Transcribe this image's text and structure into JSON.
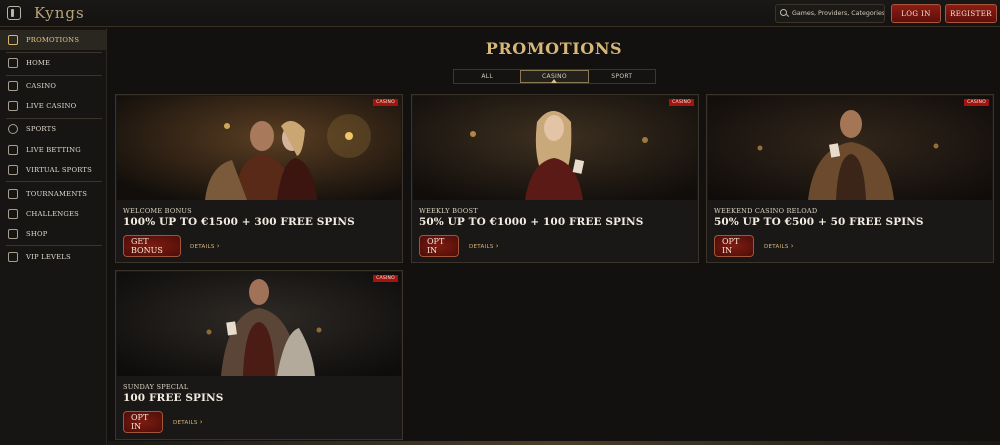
{
  "header": {
    "logo": "Kyngs",
    "search_placeholder": "Games, Providers, Categories",
    "login_label": "LOG IN",
    "register_label": "REGISTER"
  },
  "sidebar": {
    "items": [
      {
        "label": "PROMOTIONS",
        "icon": "gift-icon"
      },
      {
        "label": "HOME",
        "icon": "home-icon"
      },
      {
        "label": "CASINO",
        "icon": "casino-icon"
      },
      {
        "label": "LIVE CASINO",
        "icon": "live-casino-icon"
      },
      {
        "label": "SPORTS",
        "icon": "sports-icon"
      },
      {
        "label": "LIVE BETTING",
        "icon": "live-betting-icon"
      },
      {
        "label": "VIRTUAL SPORTS",
        "icon": "virtual-sports-icon"
      },
      {
        "label": "TOURNAMENTS",
        "icon": "trophy-icon"
      },
      {
        "label": "CHALLENGES",
        "icon": "challenges-icon"
      },
      {
        "label": "SHOP",
        "icon": "shop-icon"
      },
      {
        "label": "VIP LEVELS",
        "icon": "diamond-icon"
      }
    ]
  },
  "main": {
    "title": "PROMOTIONS",
    "tabs": [
      "ALL",
      "CASINO",
      "SPORT"
    ],
    "active_tab": "CASINO",
    "cards": [
      {
        "badge": "CASINO",
        "subtitle": "WELCOME BONUS",
        "title": "100% UP TO €1500 + 300 FREE SPINS",
        "button": "GET BONUS",
        "details": "DETAILS"
      },
      {
        "badge": "CASINO",
        "subtitle": "WEEKLY BOOST",
        "title": "50% UP TO €1000 + 100 FREE SPINS",
        "button": "OPT IN",
        "details": "DETAILS"
      },
      {
        "badge": "CASINO",
        "subtitle": "WEEKEND CASINO RELOAD",
        "title": "50% UP TO €500 + 50 FREE SPINS",
        "button": "OPT IN",
        "details": "DETAILS"
      },
      {
        "badge": "CASINO",
        "subtitle": "SUNDAY SPECIAL",
        "title": "100 FREE SPINS",
        "button": "OPT IN",
        "details": "DETAILS"
      }
    ]
  },
  "colors": {
    "background": "#121110",
    "accent_gold": "#d7b777",
    "button_red": "#8a1d14",
    "badge_red": "#a3140e"
  }
}
